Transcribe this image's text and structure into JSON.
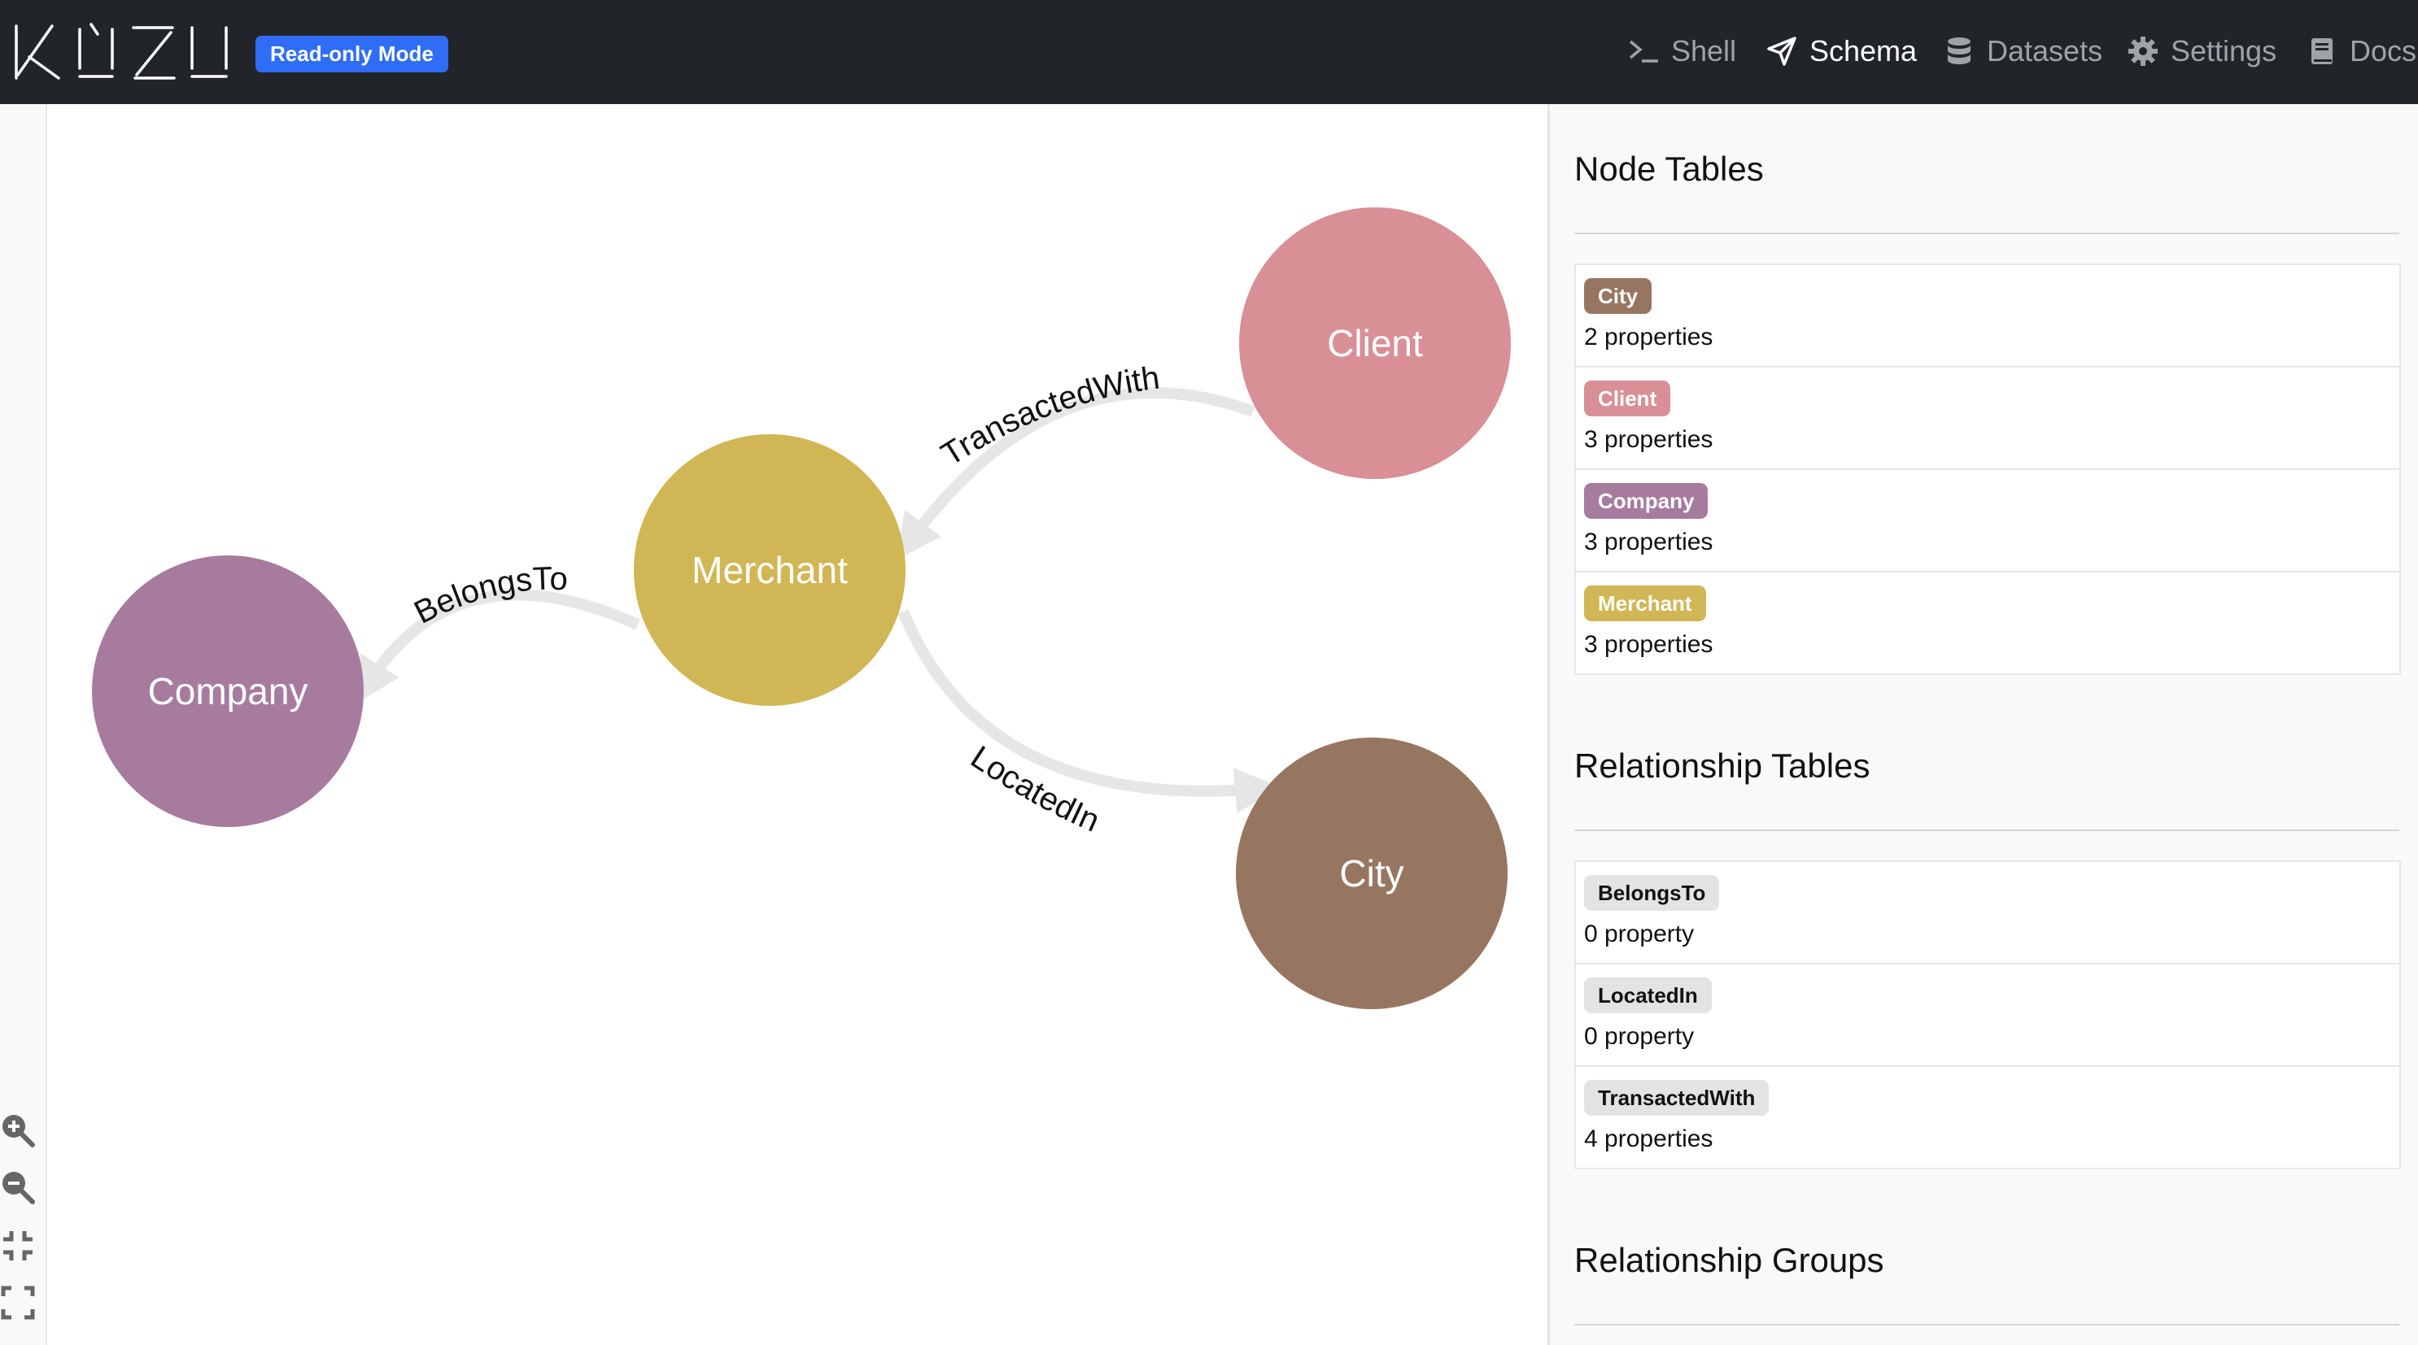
{
  "header": {
    "mode_badge": "Read-only Mode",
    "nav": {
      "shell": "Shell",
      "schema": "Schema",
      "datasets": "Datasets",
      "settings": "Settings",
      "docs": "Docs"
    }
  },
  "graph": {
    "nodes": {
      "client": {
        "label": "Client",
        "color": "#d88f95"
      },
      "merchant": {
        "label": "Merchant",
        "color": "#d0b654"
      },
      "company": {
        "label": "Company",
        "color": "#a67b9e"
      },
      "city": {
        "label": "City",
        "color": "#977661"
      }
    },
    "edges": {
      "transacted_with": "TransactedWith",
      "belongs_to": "BelongsTo",
      "located_in": "LocatedIn"
    }
  },
  "panel": {
    "node_tables_title": "Node Tables",
    "node_tables": [
      {
        "name": "City",
        "props": "2 properties",
        "color": "#977661"
      },
      {
        "name": "Client",
        "props": "3 properties",
        "color": "#d88f95"
      },
      {
        "name": "Company",
        "props": "3 properties",
        "color": "#a67b9e"
      },
      {
        "name": "Merchant",
        "props": "3 properties",
        "color": "#d0b654"
      }
    ],
    "rel_tables_title": "Relationship Tables",
    "rel_tables": [
      {
        "name": "BelongsTo",
        "props": "0 property"
      },
      {
        "name": "LocatedIn",
        "props": "0 property"
      },
      {
        "name": "TransactedWith",
        "props": "4 properties"
      }
    ],
    "rel_groups_title": "Relationship Groups"
  }
}
